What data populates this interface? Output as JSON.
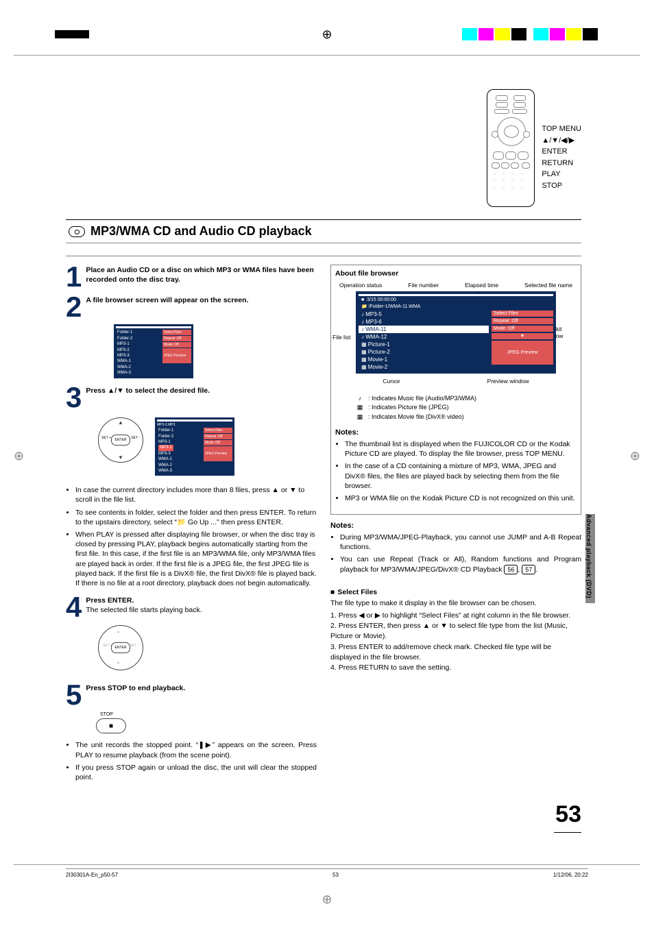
{
  "crop": {
    "center_glyph": "⊕"
  },
  "remote_labels": [
    "TOP MENU",
    "▲/▼/◀/▶",
    "ENTER",
    "RETURN",
    "PLAY",
    "STOP"
  ],
  "section_title": "MP3/WMA CD and Audio CD playback",
  "steps": {
    "s1": {
      "num": "1",
      "text": "Place an Audio CD or a disc on which MP3 or WMA files have been recorded onto the disc tray."
    },
    "s2": {
      "num": "2",
      "text": "A file browser screen will appear on the screen."
    },
    "s3": {
      "num": "3",
      "text": "Press ▲/▼ to select the desired file."
    },
    "s4": {
      "num": "4",
      "title": "Press ENTER.",
      "sub": "The selected file starts playing back."
    },
    "s5": {
      "num": "5",
      "text": "Press STOP to end playback."
    }
  },
  "navpad_center": "ENTER",
  "mini_browser": {
    "header": "",
    "items": [
      "Folder-1",
      "Folder-2",
      "MP3-1",
      "MP3-2",
      "MP3-3",
      "WMA-1",
      "WMA-2",
      "WMA-3"
    ],
    "right": [
      "Select Files",
      "Repeat  :Off",
      "Mode    :Off",
      "JPEG Preview"
    ]
  },
  "mini_browser2_title": "MP3-2.MP3",
  "left_notes": [
    "In case the current directory includes more than 8 files, press ▲ or ▼ to scroll in the file list.",
    "To see contents in folder, select the folder and then press ENTER. To return to the upstairs directory, select “📁 Go Up ...” then press ENTER.",
    "When PLAY is pressed after displaying file browser, or when the disc tray is closed by pressing PLAY, playback begins automatically starting from the first file. In this case, if the first file is an MP3/WMA file, only MP3/WMA files are played back in order. If the first file is a JPEG file, the first JPEG file is played back. If the first file is a DivX® file, the first DivX® file is played back. If there is no file at a root directory, playback does not begin automatically."
  ],
  "stop_label": "STOP",
  "step5_notes": [
    "The unit records the stopped point. “❚▶” appears on the screen. Press PLAY to resume playback (from the scene point).",
    "If you press STOP again or unload the disc, the unit will clear the stopped point."
  ],
  "browser": {
    "title": "About file browser",
    "top_labels": [
      "Operation status",
      "File number",
      "Elapsed time",
      "Selected file name"
    ],
    "status": "3/15  00:00:00",
    "path": "/Folder-1/WMA-11.WMA",
    "files": [
      {
        "icon": "♪",
        "name": "MP3-5"
      },
      {
        "icon": "♪",
        "name": "MP3-6"
      },
      {
        "icon": "♪",
        "name": "WMA-11",
        "hl": true
      },
      {
        "icon": "♪",
        "name": "WMA-12"
      },
      {
        "icon": "▦",
        "name": "Picture-1"
      },
      {
        "icon": "▦",
        "name": "Picture-2"
      },
      {
        "icon": "▦",
        "name": "Movie-1"
      },
      {
        "icon": "▦",
        "name": "Movie-2"
      }
    ],
    "toolkit": [
      "Select Files",
      "Repeat    :Off",
      "Mode      :Off"
    ],
    "scroll": "▼",
    "preview": "JPEG Preview",
    "anno_left": "File list",
    "anno_toolkit": "Tool kit window",
    "anno_cursor": "Cursor",
    "anno_preview": "Preview window"
  },
  "legend_items": [
    {
      "sym": "♪",
      "text": ": Indicates Music file (Audio/MP3/WMA)"
    },
    {
      "sym": "▦",
      "text": ": Indicates Picture file (JPEG)"
    },
    {
      "sym": "▦",
      "text": ": Indicates Movie file (DivX® video)"
    }
  ],
  "right_notes1_head": "Notes:",
  "right_notes1": [
    "The thumbnail list is displayed when the FUJICOLOR CD or the Kodak Picture CD are played. To display the file browser, press TOP MENU.",
    "In the case of a CD containing a mixture of MP3, WMA, JPEG and DivX® files, the files are played back by selecting them from the file browser.",
    "MP3 or WMA file on the Kodak Picture CD is not recognized on this unit."
  ],
  "right_notes2_head": "Notes:",
  "right_notes2_items": [
    "During MP3/WMA/JPEG-Playback, you cannot use JUMP and A-B Repeat functions.",
    "You can use Repeat (Track or All), Random functions and Program playback for MP3/WMA/JPEG/DivX® CD Playback"
  ],
  "page_refs": [
    "56",
    "57"
  ],
  "select_files": {
    "head": "Select Files",
    "intro": "The file type to make it display in the file browser can be chosen.",
    "steps": [
      "Press ◀ or ▶ to highlight “Select Files” at right column in the file browser.",
      "Press ENTER, then press ▲ or ▼ to select file type from the list (Music, Picture or Movie).",
      "Press ENTER to add/remove check mark. Checked file type will be displayed in the file browser.",
      "Press RETURN to save the setting."
    ]
  },
  "side_tab": "Advanced playback (DVD)",
  "page_number": "53",
  "footer": {
    "left": "2I30301A-En_p50-57",
    "center": "53",
    "right": "1/12/06, 20:22"
  }
}
